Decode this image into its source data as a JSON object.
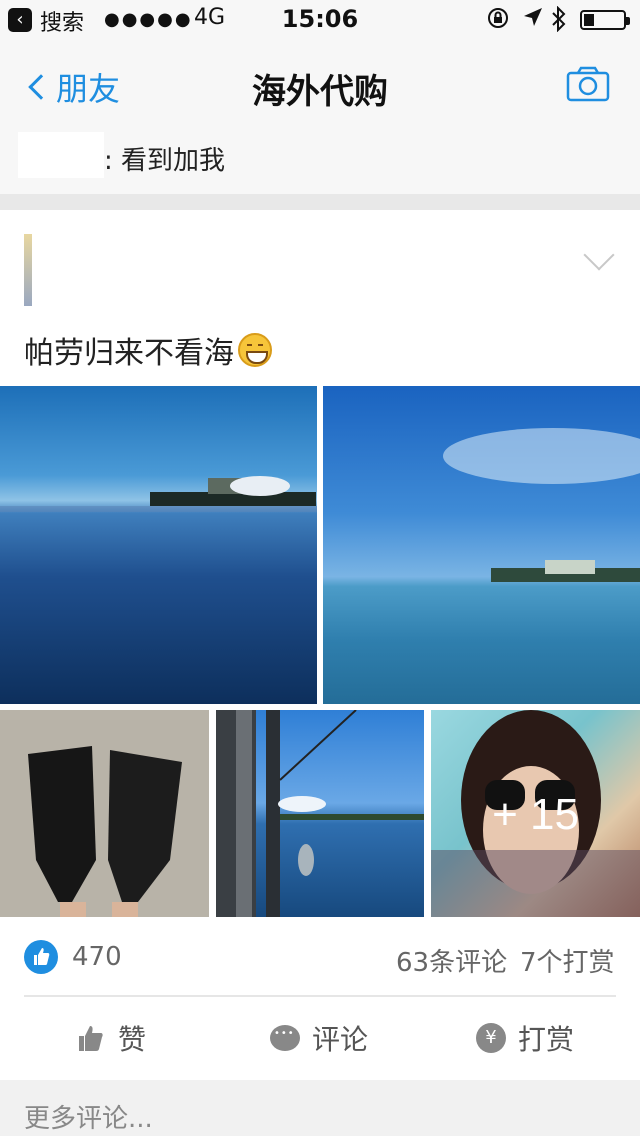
{
  "status_bar": {
    "back_to": "搜索",
    "signal": "●●●●●",
    "network": "4G",
    "time": "15:06",
    "icons": [
      "lock-rotation-icon",
      "location-icon",
      "bluetooth-icon",
      "battery-icon"
    ]
  },
  "nav": {
    "back_label": "朋友",
    "title": "海外代购",
    "right_icon": "camera-icon",
    "accent_color": "#1f8ee0"
  },
  "pinned": {
    "text": ": 看到加我"
  },
  "post": {
    "text": "帕劳归来不看海",
    "emoji": "grinning-face",
    "photos": [
      {
        "name": "palau-lagoon-photo"
      },
      {
        "name": "palau-sea-sky-photo"
      },
      {
        "name": "diving-fins-photo"
      },
      {
        "name": "fishing-boat-photo"
      },
      {
        "name": "selfie-photo",
        "overlay": "+ 15"
      }
    ],
    "likes": "470",
    "comments": "63条评论",
    "tips": "7个打赏"
  },
  "actions": {
    "like_label": "赞",
    "comment_label": "评论",
    "tip_label": "打赏"
  },
  "footer": {
    "more_comments": "更多评论..."
  }
}
